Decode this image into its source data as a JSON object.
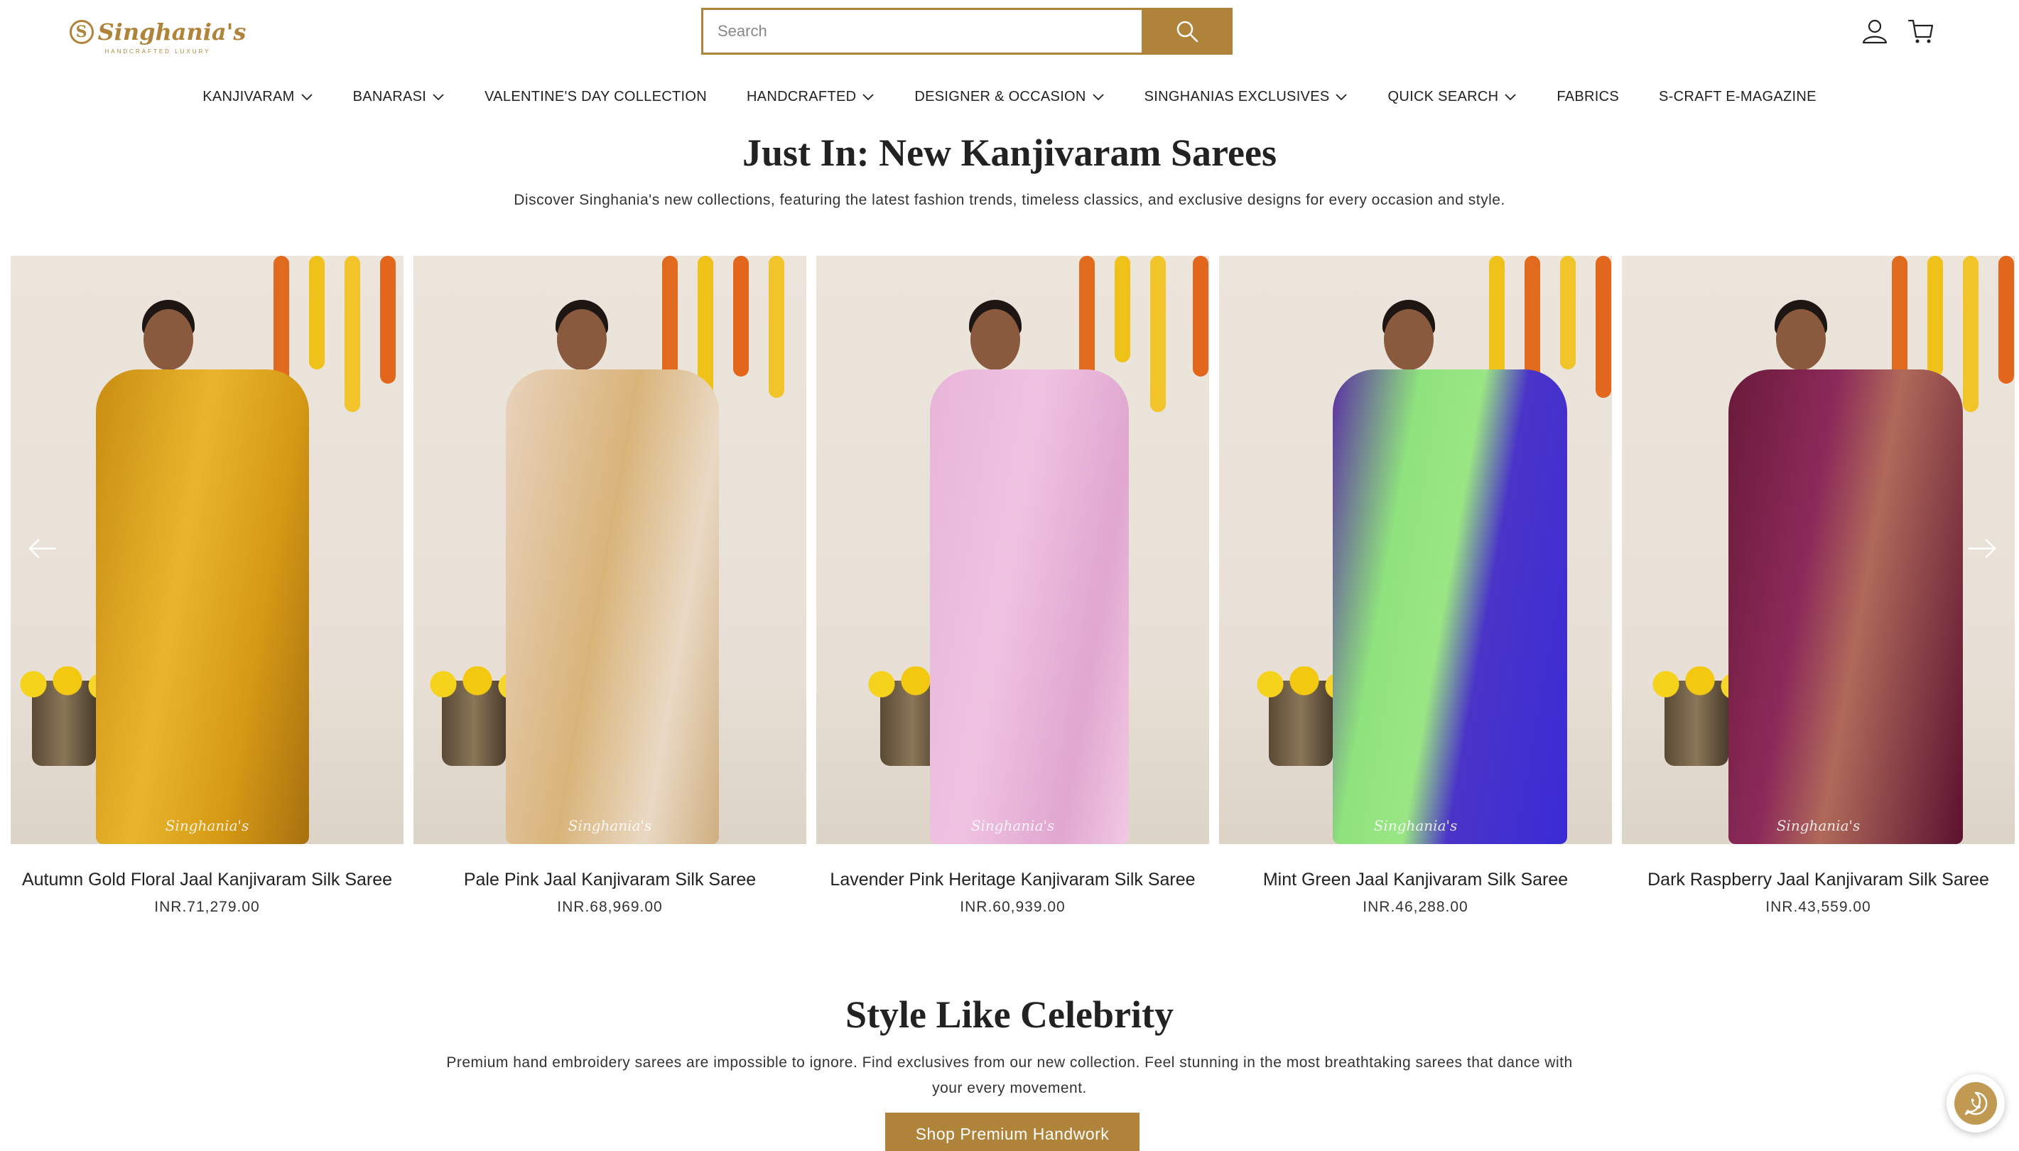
{
  "brand": {
    "name": "Singhania's",
    "tagline": "HANDCRAFTED LUXURY",
    "accent_color": "#b0833a"
  },
  "search": {
    "placeholder": "Search",
    "value": ""
  },
  "header_icons": [
    "user-icon",
    "cart-icon"
  ],
  "nav": {
    "items": [
      {
        "label": "KANJIVARAM",
        "dropdown": true
      },
      {
        "label": "BANARASI",
        "dropdown": true
      },
      {
        "label": "VALENTINE'S DAY COLLECTION",
        "dropdown": false
      },
      {
        "label": "HANDCRAFTED",
        "dropdown": true
      },
      {
        "label": "DESIGNER & OCCASION",
        "dropdown": true
      },
      {
        "label": "SINGHANIAS EXCLUSIVES",
        "dropdown": true
      },
      {
        "label": "QUICK SEARCH",
        "dropdown": true
      },
      {
        "label": "FABRICS",
        "dropdown": false
      },
      {
        "label": "S-CRAFT E-MAGAZINE",
        "dropdown": false
      }
    ]
  },
  "new_arrivals": {
    "title": "Just In: New Kanjivaram Sarees",
    "description": "Discover Singhania's new collections, featuring the latest fashion trends, timeless classics, and exclusive designs for every occasion and style.",
    "products": [
      {
        "name": "Autumn Gold Floral Jaal Kanjivaram Silk Saree",
        "price": "INR.71,279.00",
        "watermark": "Singhania's"
      },
      {
        "name": "Pale Pink Jaal Kanjivaram Silk Saree",
        "price": "INR.68,969.00",
        "watermark": "Singhania's"
      },
      {
        "name": "Lavender Pink Heritage Kanjivaram Silk Saree",
        "price": "INR.60,939.00",
        "watermark": "Singhania's"
      },
      {
        "name": "Mint Green Jaal Kanjivaram Silk Saree",
        "price": "INR.46,288.00",
        "watermark": "Singhania's"
      },
      {
        "name": "Dark Raspberry Jaal Kanjivaram Silk Saree",
        "price": "INR.43,559.00",
        "watermark": "Singhania's"
      }
    ]
  },
  "celebrity": {
    "title": "Style Like Celebrity",
    "description": "Premium hand embroidery sarees are impossible to ignore. Find exclusives from our new collection. Feel stunning in the most breathtaking sarees that dance with your every movement.",
    "cta_label": "Shop Premium Handwork"
  },
  "floating": {
    "icon": "whatsapp-icon"
  }
}
